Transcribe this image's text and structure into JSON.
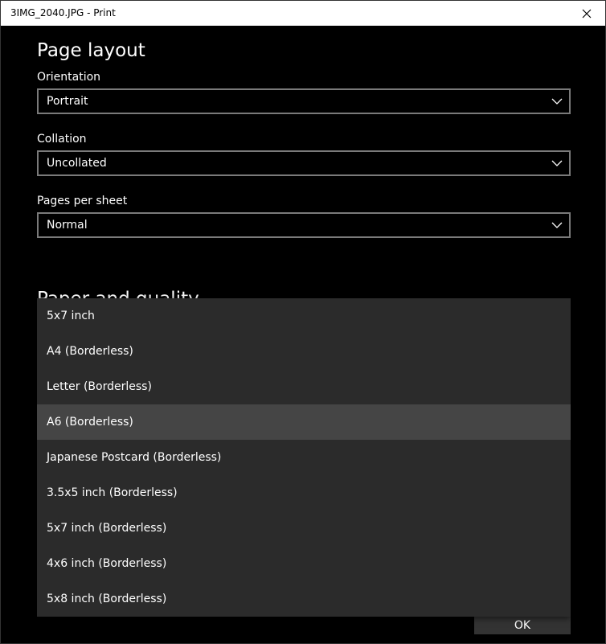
{
  "window": {
    "title": "3IMG_2040.JPG - Print"
  },
  "page_layout": {
    "heading": "Page layout",
    "orientation": {
      "label": "Orientation",
      "value": "Portrait"
    },
    "collation": {
      "label": "Collation",
      "value": "Uncollated"
    },
    "pages_per_sheet": {
      "label": "Pages per sheet",
      "value": "Normal"
    }
  },
  "paper_quality": {
    "heading": "Paper and quality"
  },
  "paper_size_dropdown": {
    "items": [
      {
        "label": "5x7 inch"
      },
      {
        "label": "A4 (Borderless)"
      },
      {
        "label": "Letter (Borderless)"
      },
      {
        "label": "A6 (Borderless)"
      },
      {
        "label": "Japanese Postcard (Borderless)"
      },
      {
        "label": "3.5x5 inch (Borderless)"
      },
      {
        "label": "5x7 inch (Borderless)"
      },
      {
        "label": "4x6 inch (Borderless)"
      },
      {
        "label": "5x8 inch (Borderless)"
      }
    ],
    "highlighted_index": 3
  },
  "footer": {
    "ok_label": "OK"
  },
  "icons": {
    "close": "close-icon",
    "chevron": "chevron-down-icon"
  },
  "colors": {
    "background": "#000000",
    "titlebar": "#ffffff",
    "dropdown_bg": "#2b2b2b",
    "dropdown_selected": "#454545",
    "combo_border": "#7a7a7a"
  }
}
